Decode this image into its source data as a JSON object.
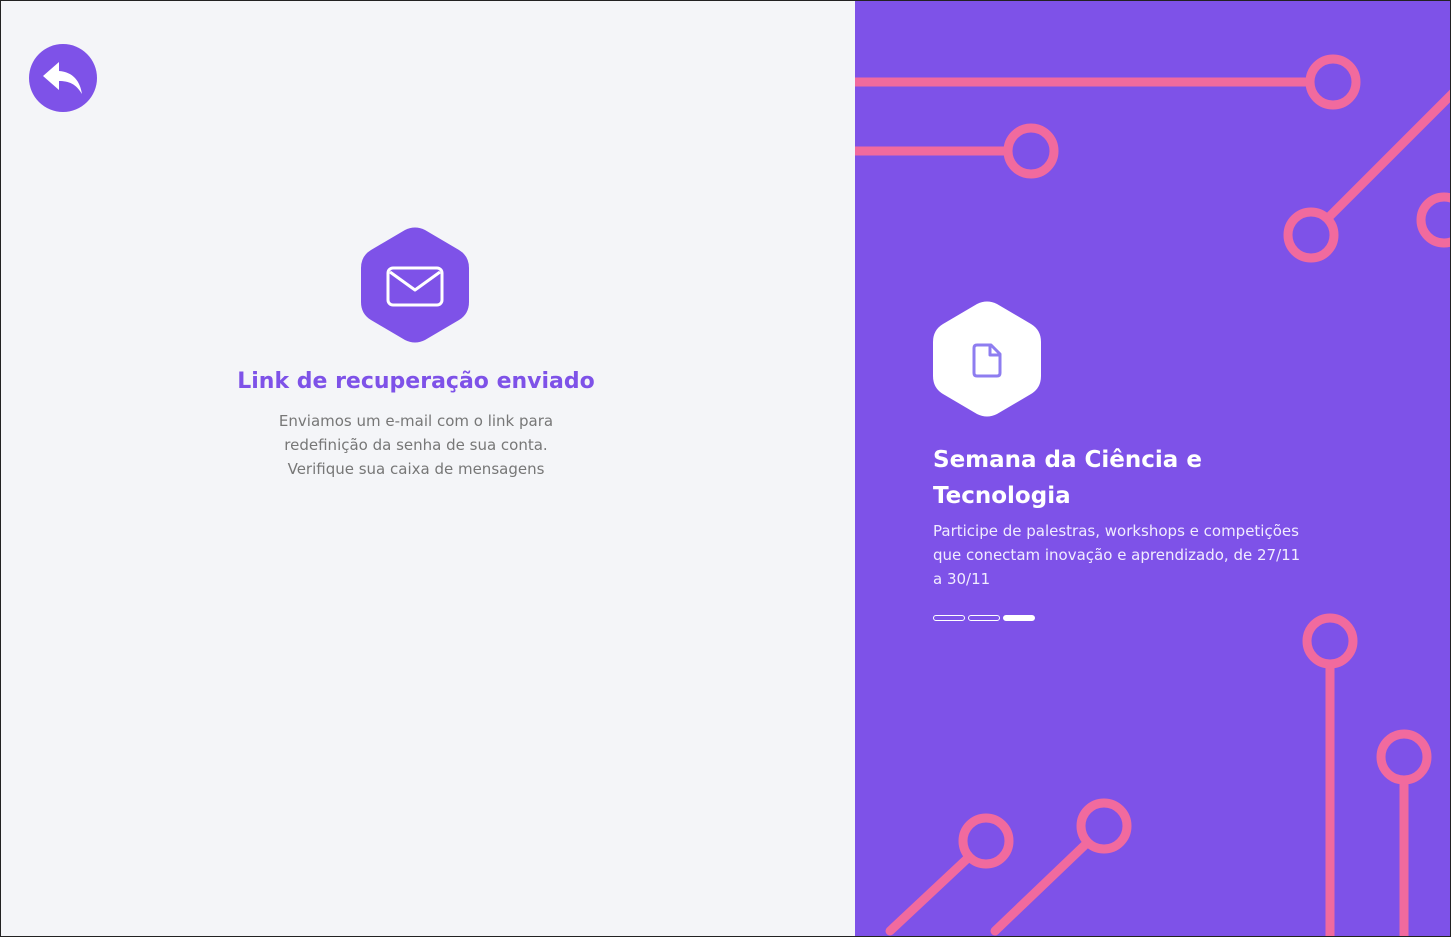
{
  "back_button": {
    "icon": "reply-arrow-icon"
  },
  "success": {
    "icon": "envelope-icon",
    "title": "Link de recuperação enviado",
    "lines": [
      "Enviamos um e-mail com o link para",
      "redefinição da senha de sua conta.",
      "Verifique sua caixa de mensagens"
    ]
  },
  "promo": {
    "icon": "document-icon",
    "title_lines": [
      "Semana da Ciência e",
      "Tecnologia"
    ],
    "text_lines": [
      "Participe de palestras, workshops e competições",
      "que conectam inovação e aprendizado, de 27/11",
      "a 30/11"
    ],
    "carousel": {
      "count": 3,
      "active_index": 2
    }
  },
  "colors": {
    "accent": "#7e52e8",
    "circuit": "#f16a9e",
    "background": "#f4f5f8",
    "text_muted": "#777777"
  }
}
